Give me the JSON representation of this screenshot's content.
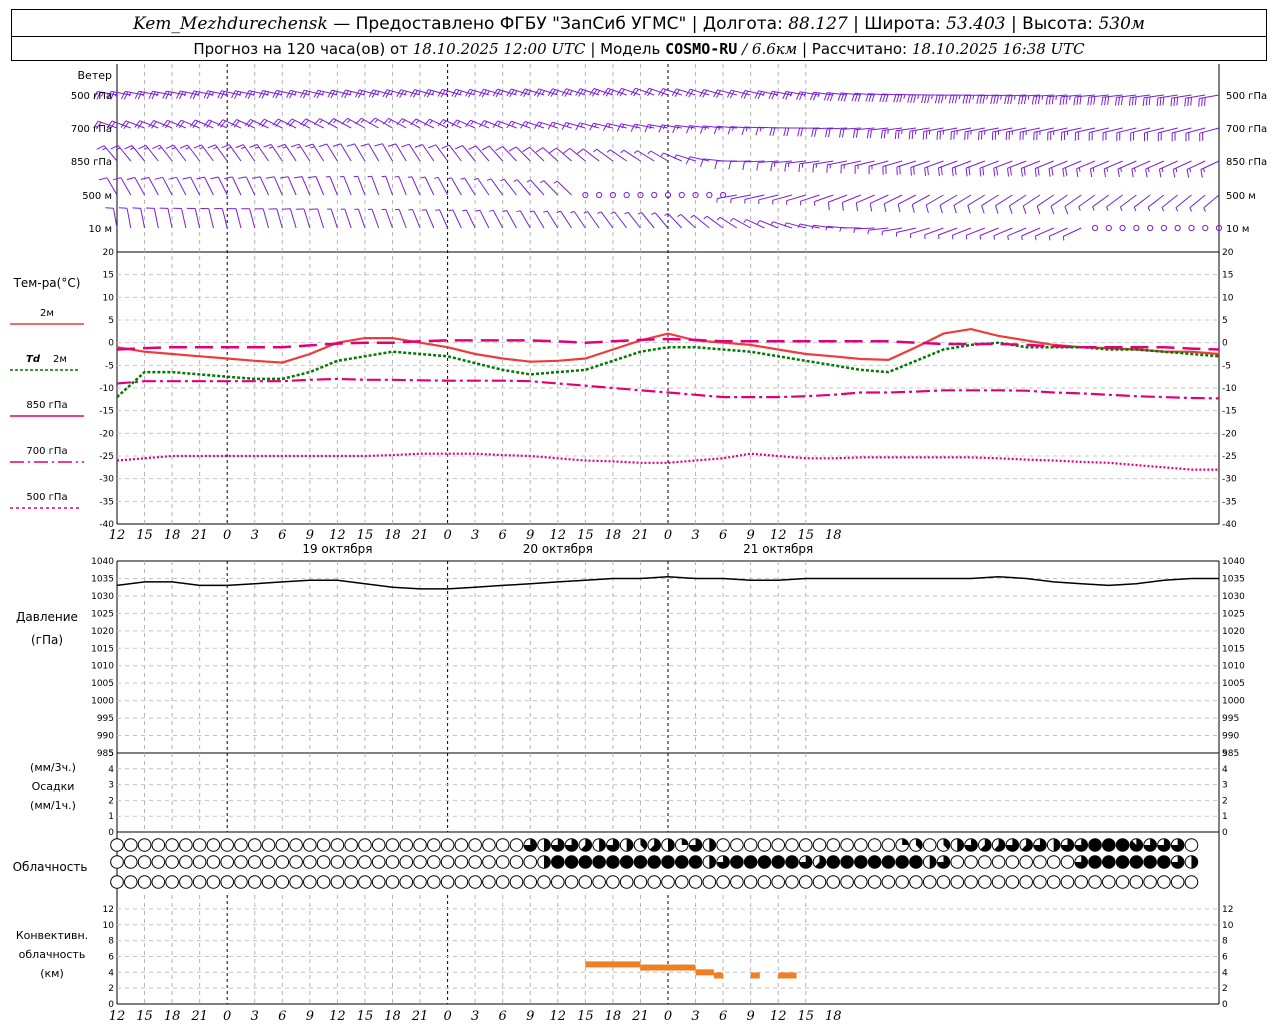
{
  "header": {
    "station": "Kem_Mezhdurechensk",
    "provided": "— Предоставлено ФГБУ \"ЗапСиб УГМС\"",
    "lon_label": "Долгота:",
    "lon": "88.127",
    "lat_label": "Широта:",
    "lat": "53.403",
    "alt_label": "Высота:",
    "alt": "530м",
    "forecast_prefix": "Прогноз на 120 часа(ов) от",
    "forecast_time": "18.10.2025 12:00 UTC",
    "model_label": "Модель",
    "model": "COSMO-RU",
    "resolution": "/ 6.6км",
    "computed_label": "Рассчитано:",
    "computed_time": "18.10.2025 16:38 UTC"
  },
  "time_axis": {
    "hour_labels": [
      "12",
      "15",
      "18",
      "21",
      "0",
      "3",
      "6",
      "9",
      "12",
      "15",
      "18",
      "21",
      "0",
      "3",
      "6",
      "9",
      "12",
      "15",
      "18",
      "21",
      "0",
      "3",
      "6",
      "9",
      "12",
      "15",
      "18"
    ],
    "date_labels": [
      {
        "hour_index": 8,
        "text": "19 октября"
      },
      {
        "hour_index": 16,
        "text": "20 октября"
      },
      {
        "hour_index": 24,
        "text": "21 октября"
      }
    ],
    "day_boundary_indices": [
      4,
      12,
      20
    ]
  },
  "labels": {
    "wind": "Ветер",
    "wind_levels": [
      "500 гПа",
      "700 гПа",
      "850 гПа",
      "500 м",
      "10 м"
    ],
    "temp": "Тем-ра(°C)",
    "legend_t2m": "2м",
    "legend_td_a": "Td",
    "legend_td_b": "2м",
    "legend_850": "850 гПа",
    "legend_700": "700 гПа",
    "legend_500": "500 гПа",
    "pressure_a": "Давление",
    "pressure_b": "(гПа)",
    "precip_a": "(мм/3ч.)",
    "precip_b": "Осадки",
    "precip_c": "(мм/1ч.)",
    "cloud": "Облачность",
    "conv_a": "Конвективн.",
    "conv_b": "облачность",
    "conv_c": "(км)"
  },
  "colors": {
    "wind": "#7a1fd6",
    "t2m": "#ee3b3b",
    "td2m": "#007a00",
    "t850": "#e0007a",
    "t700": "#e0007a",
    "t500": "#e0007a",
    "conv": "#ef7f22"
  },
  "chart_data": [
    {
      "type": "line",
      "name": "temperature",
      "ylim": [
        -40,
        20
      ],
      "yticks": [
        20,
        15,
        10,
        5,
        0,
        -5,
        -10,
        -15,
        -20,
        -25,
        -30,
        -35,
        -40
      ],
      "x_hours": [
        0,
        3,
        6,
        9,
        12,
        15,
        18,
        21,
        24,
        27,
        30,
        33,
        36,
        39,
        42,
        45,
        48,
        51,
        54,
        57,
        60,
        63,
        66,
        69,
        72,
        75,
        78,
        81,
        84,
        87,
        90,
        93,
        96,
        99,
        102,
        105,
        108,
        111,
        114,
        117,
        120
      ],
      "series": [
        {
          "key": "t2m",
          "values": [
            -1.0,
            -2.0,
            -2.5,
            -3.0,
            -3.5,
            -4.0,
            -4.4,
            -2.5,
            0.0,
            1.0,
            1.0,
            0.0,
            -1.0,
            -2.5,
            -3.5,
            -4.2,
            -4.0,
            -3.5,
            -1.5,
            0.5,
            2.0,
            0.5,
            0.0,
            -0.5,
            -1.5,
            -2.5,
            -3.0,
            -3.6,
            -3.8,
            -1.0,
            2.0,
            3.0,
            1.5,
            0.5,
            -0.5,
            -1.0,
            -1.2,
            -1.5,
            -2.0,
            -2.0,
            -2.5
          ]
        },
        {
          "key": "td2m",
          "values": [
            -12.0,
            -6.5,
            -6.5,
            -7.0,
            -7.5,
            -8.0,
            -8.0,
            -6.5,
            -4.0,
            -3.0,
            -2.0,
            -2.5,
            -3.0,
            -4.5,
            -6.0,
            -7.0,
            -6.5,
            -6.0,
            -4.0,
            -2.0,
            -1.0,
            -1.0,
            -1.5,
            -2.0,
            -3.0,
            -4.0,
            -5.0,
            -6.0,
            -6.5,
            -4.0,
            -1.5,
            -0.5,
            0.0,
            -1.0,
            -1.0,
            -1.0,
            -1.5,
            -1.5,
            -2.0,
            -2.5,
            -3.0
          ]
        },
        {
          "key": "t850",
          "values": [
            -9.0,
            -8.5,
            -8.5,
            -8.5,
            -8.5,
            -8.5,
            -8.5,
            -8.2,
            -8.0,
            -8.2,
            -8.2,
            -8.3,
            -8.4,
            -8.4,
            -8.4,
            -8.5,
            -9.0,
            -9.5,
            -10.0,
            -10.5,
            -11.0,
            -11.5,
            -12.0,
            -12.0,
            -12.0,
            -11.8,
            -11.5,
            -11.0,
            -11.0,
            -10.8,
            -10.5,
            -10.5,
            -10.5,
            -10.6,
            -11.0,
            -11.2,
            -11.5,
            -11.8,
            -12.0,
            -12.2,
            -12.3
          ]
        },
        {
          "key": "t700",
          "values": [
            -1.5,
            -1.2,
            -1.0,
            -1.0,
            -1.0,
            -1.0,
            -1.0,
            -0.6,
            -0.2,
            0.0,
            0.0,
            0.3,
            0.5,
            0.5,
            0.5,
            0.5,
            0.3,
            0.0,
            0.3,
            0.6,
            0.8,
            0.6,
            0.3,
            0.3,
            0.3,
            0.3,
            0.3,
            0.3,
            0.3,
            0.0,
            -0.3,
            -0.3,
            -0.3,
            -0.5,
            -0.8,
            -1.0,
            -1.0,
            -1.0,
            -1.0,
            -1.3,
            -1.5
          ]
        },
        {
          "key": "t500",
          "values": [
            -26.0,
            -25.5,
            -25.0,
            -25.0,
            -25.0,
            -25.0,
            -25.0,
            -25.0,
            -25.0,
            -25.0,
            -24.8,
            -24.5,
            -24.5,
            -24.5,
            -24.8,
            -25.0,
            -25.5,
            -26.0,
            -26.2,
            -26.5,
            -26.5,
            -26.0,
            -25.5,
            -24.5,
            -25.0,
            -25.5,
            -25.5,
            -25.3,
            -25.3,
            -25.3,
            -25.3,
            -25.3,
            -25.5,
            -25.8,
            -26.0,
            -26.3,
            -26.5,
            -27.0,
            -27.5,
            -28.0,
            -28.0
          ]
        }
      ]
    },
    {
      "type": "line",
      "name": "pressure",
      "ylim": [
        985,
        1040
      ],
      "yticks": [
        1040,
        1035,
        1030,
        1025,
        1020,
        1015,
        1010,
        1005,
        1000,
        995,
        990,
        985
      ],
      "x_hours": [
        0,
        3,
        6,
        9,
        12,
        15,
        18,
        21,
        24,
        27,
        30,
        33,
        36,
        39,
        42,
        45,
        48,
        51,
        54,
        57,
        60,
        63,
        66,
        69,
        72,
        75,
        78,
        81,
        84,
        87,
        90,
        93,
        96,
        99,
        102,
        105,
        108,
        111,
        114,
        117,
        120
      ],
      "values": [
        1033.0,
        1034.0,
        1034.0,
        1033.0,
        1033.0,
        1033.5,
        1034.0,
        1034.5,
        1034.5,
        1033.5,
        1032.5,
        1032.0,
        1032.0,
        1032.5,
        1033.0,
        1033.5,
        1034.0,
        1034.5,
        1035.0,
        1035.0,
        1035.5,
        1035.0,
        1035.0,
        1034.5,
        1034.5,
        1035.0,
        1035.0,
        1035.0,
        1035.0,
        1035.0,
        1035.0,
        1035.0,
        1035.5,
        1035.0,
        1034.0,
        1033.5,
        1033.0,
        1033.5,
        1034.5,
        1035.0,
        1035.0
      ]
    },
    {
      "type": "bar",
      "name": "precipitation",
      "ylim": [
        0,
        5
      ],
      "yticks": [
        5,
        4,
        3,
        2,
        1,
        0
      ],
      "values": []
    },
    {
      "type": "bar",
      "name": "convective_cloud",
      "ylim": [
        0,
        13
      ],
      "yticks": [
        12,
        10,
        8,
        6,
        4,
        2,
        0
      ],
      "segments": [
        {
          "start_h": 51,
          "end_h": 57,
          "top_km": 5.0
        },
        {
          "start_h": 57,
          "end_h": 63,
          "top_km": 4.6
        },
        {
          "start_h": 63,
          "end_h": 65,
          "top_km": 4.0
        },
        {
          "start_h": 65,
          "end_h": 66,
          "top_km": 3.6
        },
        {
          "start_h": 69,
          "end_h": 70,
          "top_km": 3.6
        },
        {
          "start_h": 72,
          "end_h": 74,
          "top_km": 3.6
        }
      ]
    }
  ],
  "cloud_cover": {
    "rows": 3,
    "count": 79,
    "step_h": 1.5,
    "row1_nonzero": [
      [
        30,
        6
      ],
      [
        31,
        4
      ],
      [
        32,
        6
      ],
      [
        33,
        6
      ],
      [
        34,
        5
      ],
      [
        35,
        4
      ],
      [
        36,
        6
      ],
      [
        37,
        4
      ],
      [
        38,
        3
      ],
      [
        39,
        5
      ],
      [
        40,
        4
      ],
      [
        41,
        2
      ],
      [
        42,
        6
      ],
      [
        43,
        4
      ],
      [
        57,
        2
      ],
      [
        58,
        3
      ],
      [
        60,
        3
      ],
      [
        61,
        4
      ],
      [
        62,
        6
      ],
      [
        63,
        5
      ],
      [
        64,
        5
      ],
      [
        65,
        6
      ],
      [
        66,
        5
      ],
      [
        67,
        6
      ],
      [
        68,
        4
      ],
      [
        69,
        6
      ],
      [
        70,
        6
      ],
      [
        71,
        8
      ],
      [
        72,
        8
      ],
      [
        73,
        8
      ],
      [
        74,
        7
      ],
      [
        75,
        6
      ],
      [
        76,
        6
      ],
      [
        77,
        6
      ]
    ],
    "row2_nonzero": [
      [
        31,
        4
      ],
      [
        32,
        8
      ],
      [
        33,
        8
      ],
      [
        34,
        8
      ],
      [
        35,
        8
      ],
      [
        36,
        8
      ],
      [
        37,
        8
      ],
      [
        38,
        8
      ],
      [
        39,
        8
      ],
      [
        40,
        8
      ],
      [
        41,
        8
      ],
      [
        42,
        8
      ],
      [
        43,
        4
      ],
      [
        44,
        6
      ],
      [
        45,
        8
      ],
      [
        46,
        8
      ],
      [
        47,
        8
      ],
      [
        48,
        8
      ],
      [
        49,
        8
      ],
      [
        50,
        6
      ],
      [
        51,
        5
      ],
      [
        52,
        8
      ],
      [
        53,
        8
      ],
      [
        54,
        8
      ],
      [
        55,
        8
      ],
      [
        56,
        8
      ],
      [
        57,
        8
      ],
      [
        58,
        8
      ],
      [
        59,
        4
      ],
      [
        60,
        6
      ],
      [
        70,
        6
      ],
      [
        71,
        8
      ],
      [
        72,
        8
      ],
      [
        73,
        8
      ],
      [
        74,
        8
      ],
      [
        75,
        8
      ],
      [
        76,
        8
      ],
      [
        77,
        6
      ],
      [
        78,
        4
      ]
    ],
    "row3_nonzero": []
  },
  "wind": {
    "start_h": 0,
    "step_h": 1.5,
    "levels": [
      {
        "dirs": [
          [
            0,
            280
          ],
          [
            40,
            290
          ],
          [
            60,
            270
          ],
          [
            80,
            260
          ]
        ],
        "speeds": [
          [
            0,
            25
          ],
          [
            30,
            25
          ],
          [
            45,
            20
          ],
          [
            60,
            35
          ],
          [
            80,
            30
          ]
        ]
      },
      {
        "dirs": [
          [
            0,
            290
          ],
          [
            20,
            300
          ],
          [
            40,
            280
          ],
          [
            60,
            260
          ],
          [
            80,
            255
          ]
        ],
        "speeds": [
          [
            0,
            20
          ],
          [
            30,
            15
          ],
          [
            45,
            15
          ],
          [
            60,
            25
          ],
          [
            80,
            20
          ]
        ]
      },
      {
        "dirs": [
          [
            0,
            320
          ],
          [
            20,
            330
          ],
          [
            40,
            300
          ],
          [
            45,
            270
          ],
          [
            60,
            250
          ],
          [
            80,
            245
          ]
        ],
        "speeds": [
          [
            0,
            15
          ],
          [
            30,
            10
          ],
          [
            40,
            5
          ],
          [
            45,
            10
          ],
          [
            60,
            20
          ],
          [
            80,
            15
          ]
        ]
      },
      {
        "dirs": [
          [
            0,
            330
          ],
          [
            20,
            340
          ],
          [
            40,
            300
          ],
          [
            45,
            260
          ],
          [
            60,
            240
          ],
          [
            80,
            230
          ]
        ],
        "speeds": [
          [
            0,
            10
          ],
          [
            30,
            5
          ],
          [
            36,
            0
          ],
          [
            44,
            0
          ],
          [
            45,
            5
          ],
          [
            60,
            10
          ],
          [
            80,
            5
          ]
        ]
      },
      {
        "dirs": [
          [
            0,
            350
          ],
          [
            20,
            340
          ],
          [
            40,
            320
          ],
          [
            60,
            250
          ],
          [
            80,
            240
          ]
        ],
        "speeds": [
          [
            0,
            10
          ],
          [
            30,
            5
          ],
          [
            40,
            5
          ],
          [
            60,
            5
          ],
          [
            80,
            0
          ]
        ]
      }
    ]
  }
}
